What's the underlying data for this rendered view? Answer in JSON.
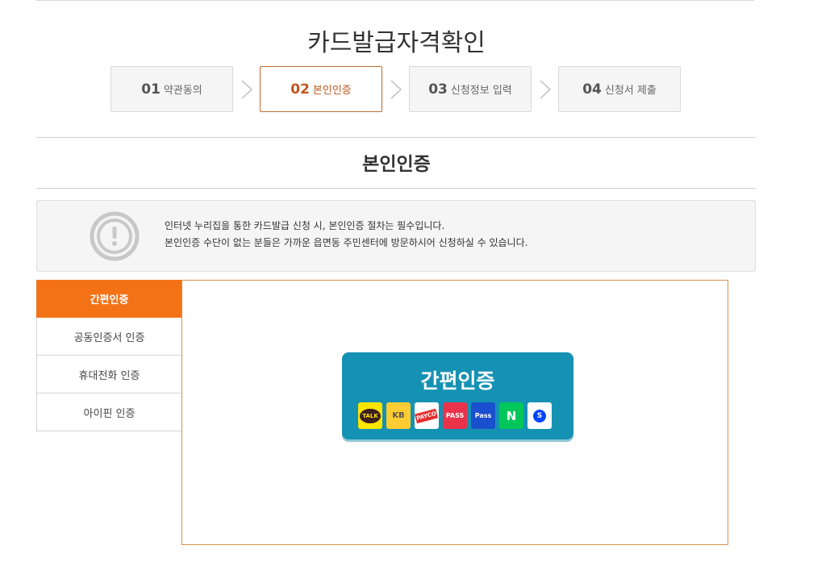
{
  "page": {
    "title": "카드발급자격확인"
  },
  "steps": [
    {
      "num": "01",
      "label": "약관동의",
      "active": false
    },
    {
      "num": "02",
      "label": "본인인증",
      "active": true
    },
    {
      "num": "03",
      "label": "신청정보 입력",
      "active": false
    },
    {
      "num": "04",
      "label": "신청서 제출",
      "active": false
    }
  ],
  "section": {
    "title": "본인인증"
  },
  "notice": {
    "icon": "exclamation-circle-icon",
    "line1": "인터넷 누리집을 통한 카드발급 신청 시, 본인인증 절차는 필수입니다.",
    "line2": "본인인증 수단이 없는 분들은 가까운 읍면동 주민센터에 방문하시어 신청하실 수 있습니다."
  },
  "tabs": [
    {
      "label": "간편인증",
      "active": true
    },
    {
      "label": "공동인증서 인증",
      "active": false
    },
    {
      "label": "휴대전화 인증",
      "active": false
    },
    {
      "label": "아이핀 인증",
      "active": false
    }
  ],
  "easy_auth": {
    "title": "간편인증",
    "providers": [
      {
        "name": "kakao",
        "label": "TALK",
        "bg": "#fee500",
        "fg": "#3c1e1e"
      },
      {
        "name": "kb",
        "label": "KB",
        "bg": "#ffcc33",
        "fg": "#555555"
      },
      {
        "name": "payco",
        "label": "PAYCO",
        "bg": "#ffffff",
        "fg": "#e62e2e"
      },
      {
        "name": "pass",
        "label": "PASS",
        "bg": "#e8334a",
        "fg": "#ffffff"
      },
      {
        "name": "samsung-pass",
        "label": "Pass",
        "bg": "#1a4fcf",
        "fg": "#ffffff"
      },
      {
        "name": "naver",
        "label": "N",
        "bg": "#03c75a",
        "fg": "#ffffff"
      },
      {
        "name": "shinhan",
        "label": "S",
        "bg": "#ffffff",
        "fg": "#0046ff"
      }
    ]
  },
  "colors": {
    "accent_orange": "#f47216",
    "active_step": "#c0561d",
    "easy_auth_bg": "#1592b3"
  }
}
